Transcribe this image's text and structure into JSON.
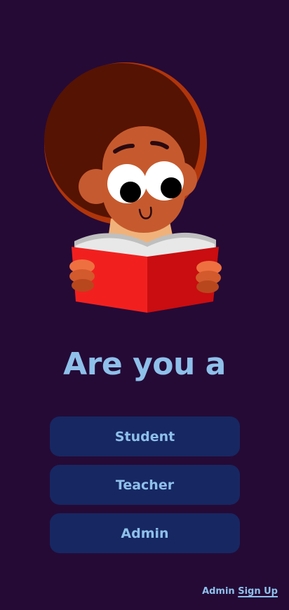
{
  "illustration": {
    "name": "child-reading-book-illustration"
  },
  "headline": "Are you a",
  "roles": [
    {
      "label": "Student"
    },
    {
      "label": "Teacher"
    },
    {
      "label": "Admin"
    }
  ],
  "footer": {
    "prefix": "Admin",
    "link": "Sign Up"
  },
  "colors": {
    "background": "#250A36",
    "button": "#172762",
    "accent_text": "#8EC0EA",
    "book_red": "#E51B1F"
  }
}
